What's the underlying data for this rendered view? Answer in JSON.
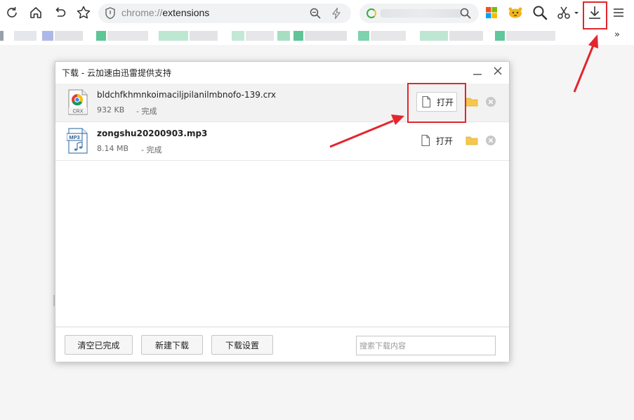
{
  "toolbar": {
    "url_scheme": "chrome://",
    "url_path": "extensions",
    "icons": [
      "reload-icon",
      "home-icon",
      "back-icon",
      "star-icon",
      "shield-icon",
      "zoom-icon",
      "bolt-icon",
      "search-icon",
      "windows-icon",
      "tiger-icon",
      "magnifier-icon",
      "scissors-icon",
      "download-icon",
      "menu-icon"
    ]
  },
  "bookmarks": {
    "overflow_label": "»"
  },
  "dialog": {
    "title": "下载 - 云加速由迅雷提供支持",
    "items": [
      {
        "name": "bldchfkhmnkoimaciljpilanilmbnofo-139.crx",
        "size": "932 KB",
        "status": "- 完成",
        "type_label": "CRX",
        "open_label": "打开",
        "selected": true
      },
      {
        "name": "zongshu20200903.mp3",
        "size": "8.14 MB",
        "status": "- 完成",
        "type_label": "MP3",
        "open_label": "打开",
        "selected": false
      }
    ],
    "footer": {
      "clear_label": "清空已完成",
      "new_label": "新建下载",
      "settings_label": "下载设置",
      "search_placeholder": "搜索下载内容"
    }
  },
  "colors": {
    "highlight": "#e3262d",
    "folder": "#f5c84b",
    "search_ring": "#2fb04a"
  }
}
